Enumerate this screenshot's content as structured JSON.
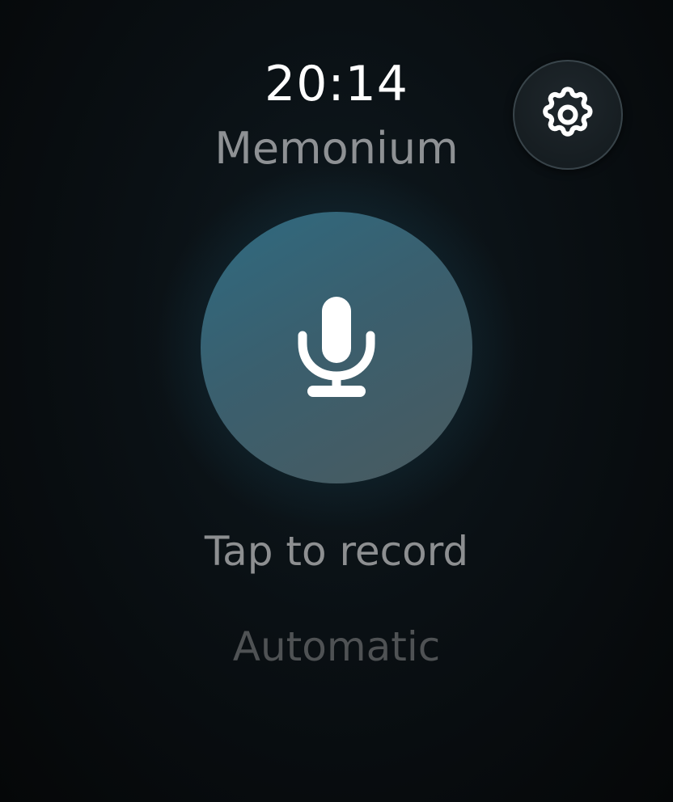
{
  "status": {
    "time": "20:14"
  },
  "app": {
    "title": "Memonium"
  },
  "settings": {
    "icon": "gear-icon"
  },
  "record": {
    "icon": "microphone-icon",
    "hint": "Tap to record",
    "mode": "Automatic"
  },
  "colors": {
    "background": "#0a1014",
    "record_button": "#3a6272",
    "primary_text": "#ffffff",
    "secondary_text": "#8e9194",
    "tertiary_text": "#4f5254"
  }
}
